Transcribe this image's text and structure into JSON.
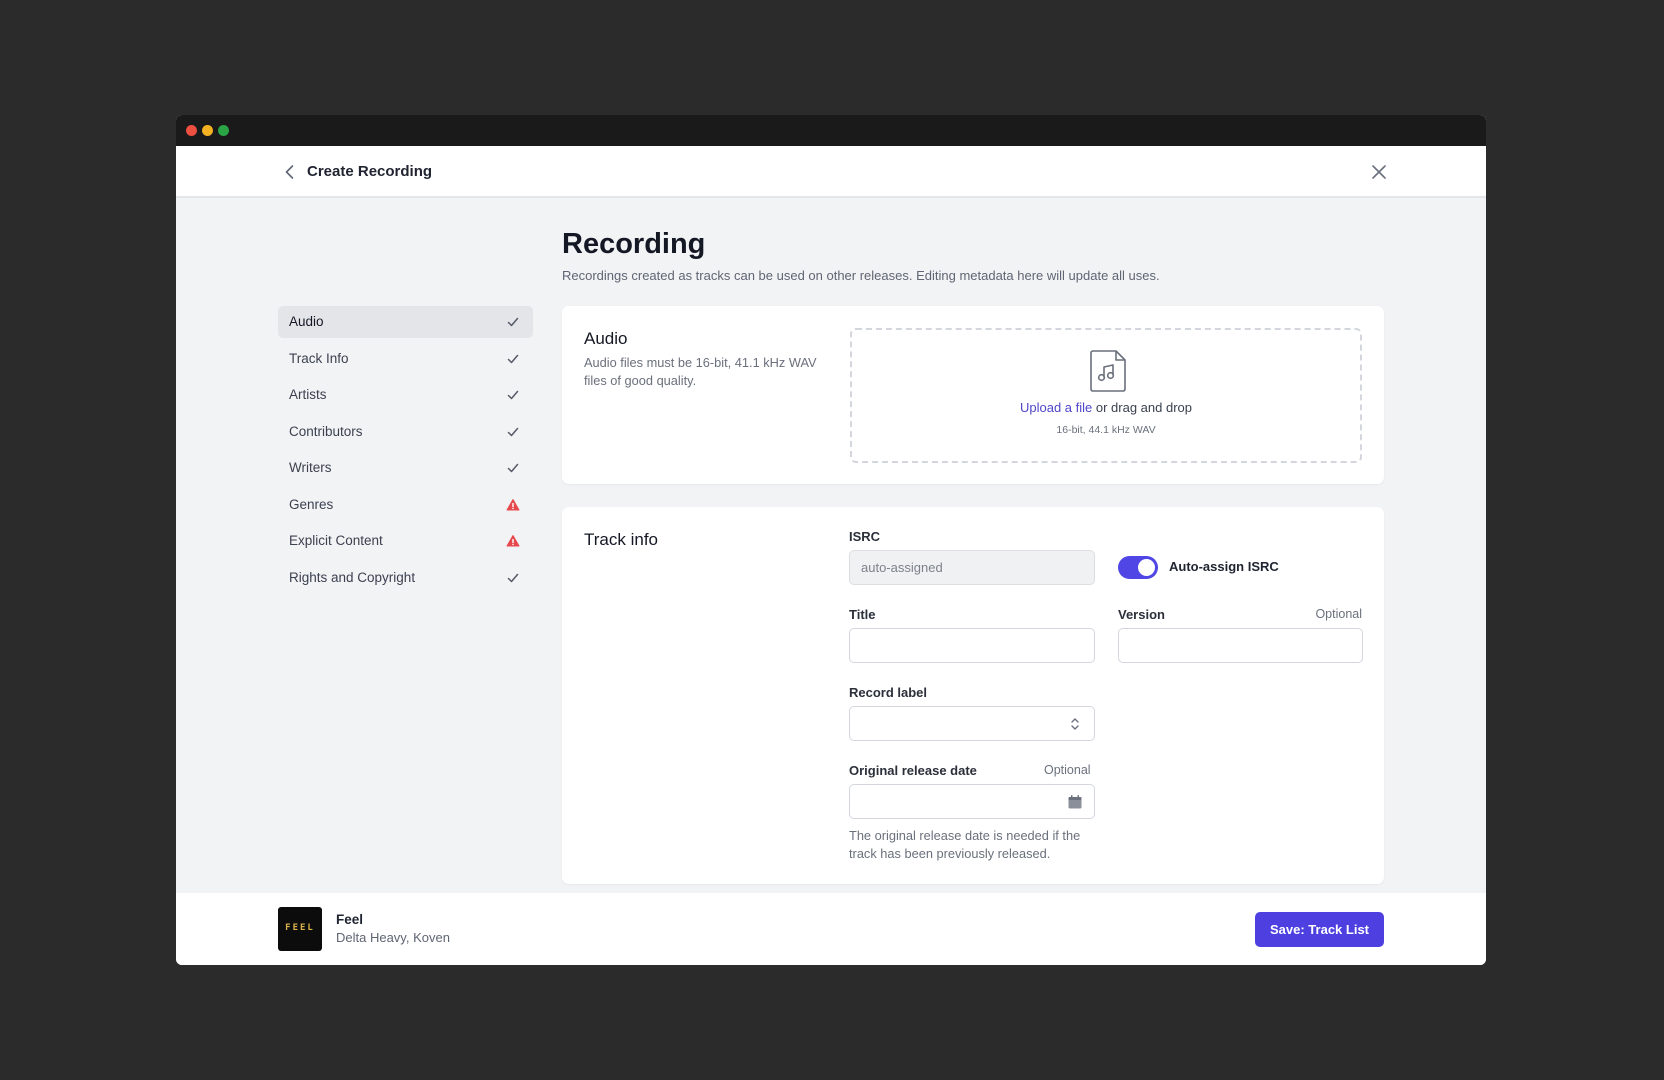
{
  "header": {
    "title": "Create Recording"
  },
  "page": {
    "title": "Recording",
    "subtitle": "Recordings created as tracks can be used on other releases. Editing metadata here will update all uses."
  },
  "sidebar": {
    "items": [
      {
        "label": "Audio",
        "status": "complete",
        "active": true
      },
      {
        "label": "Track Info",
        "status": "complete"
      },
      {
        "label": "Artists",
        "status": "complete"
      },
      {
        "label": "Contributors",
        "status": "complete"
      },
      {
        "label": "Writers",
        "status": "complete"
      },
      {
        "label": "Genres",
        "status": "warning"
      },
      {
        "label": "Explicit Content",
        "status": "warning"
      },
      {
        "label": "Rights and Copyright",
        "status": "complete"
      }
    ]
  },
  "audio": {
    "title": "Audio",
    "description": "Audio files must be 16-bit, 41.1 kHz WAV files of good quality.",
    "upload_link": "Upload a file",
    "upload_rest": " or drag and drop",
    "hint": "16-bit, 44.1 kHz WAV"
  },
  "track": {
    "title": "Track info",
    "isrc_label": "ISRC",
    "isrc_placeholder": "auto-assigned",
    "auto_assign_label": "Auto-assign ISRC",
    "auto_assign_on": true,
    "title_label": "Title",
    "version_label": "Version",
    "optional": "Optional",
    "record_label_label": "Record label",
    "release_date_label": "Original release date",
    "release_date_help": "The original release date is needed if the track has been previously released."
  },
  "footer": {
    "cover_text": "FEEL",
    "track_title": "Feel",
    "artists": "Delta Heavy, Koven",
    "save_label": "Save: Track List"
  },
  "colors": {
    "accent": "#4d3fe0",
    "warning": "#e5484d",
    "check": "#555b66"
  }
}
